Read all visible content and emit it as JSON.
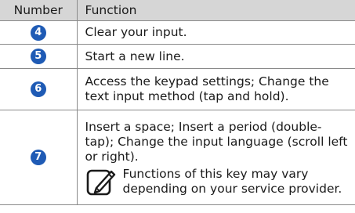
{
  "table": {
    "headers": {
      "number": "Number",
      "function": "Function"
    },
    "rows": [
      {
        "number": "4",
        "function": "Clear your input."
      },
      {
        "number": "5",
        "function": "Start a new line."
      },
      {
        "number": "6",
        "function": "Access the keypad settings; Change the text input method (tap and hold)."
      },
      {
        "number": "7",
        "function": "Insert a space; Insert a period (double-tap); Change the input language (scroll left or right)."
      }
    ],
    "note": {
      "icon": "note-pencil-icon",
      "text": "Functions of this key may vary depending on your service provider."
    }
  },
  "colors": {
    "header_bg": "#d6d6d6",
    "badge": "#1f5bb5",
    "border": "#8a8a8a"
  }
}
